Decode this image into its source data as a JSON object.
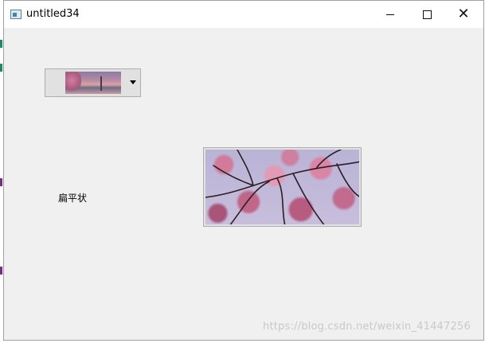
{
  "window": {
    "title": "untitled34"
  },
  "controls": {
    "combo_box_icon": "cherry-blossom-landscape-thumbnail",
    "label_text": "扁平状",
    "image_button_icon": "cherry-blossom-branches"
  },
  "watermark": "https://blog.csdn.net/weixin_41447256",
  "colors": {
    "window_background": "#f0f0f0",
    "titlebar_background": "#ffffff",
    "button_face": "#e1e1e1",
    "button_border": "#adadad"
  }
}
